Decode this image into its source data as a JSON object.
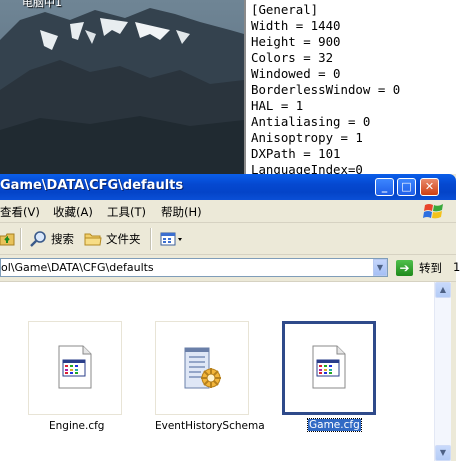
{
  "desktop": {
    "label": "电脑中1"
  },
  "notepad": {
    "lines": [
      "[General]",
      "Width = 1440",
      "Height = 900",
      "Colors = 32",
      "Windowed = 0",
      "BorderlessWindow = 0",
      "HAL = 1",
      "Antialiasing = 0",
      "Anisoptropy = 1",
      "DXPath = 101",
      "LanguageIndex=0"
    ]
  },
  "window": {
    "title": "Game\\DATA\\CFG\\defaults",
    "controls": {
      "minimize": "_",
      "maximize": "□",
      "close": "✕"
    }
  },
  "menu": {
    "items": [
      "查看(V)",
      "收藏(A)",
      "工具(T)",
      "帮助(H)"
    ]
  },
  "toolbar": {
    "search_label": "搜索",
    "folders_label": "文件夹"
  },
  "address": {
    "value": "ol\\Game\\DATA\\CFG\\defaults",
    "go_label": "转到",
    "tail": "1"
  },
  "files": [
    {
      "name": "Engine.cfg",
      "icon": "config-file-icon",
      "selected": false
    },
    {
      "name": "EventHistorySchema",
      "icon": "notepad-config-icon",
      "selected": false
    },
    {
      "name": "Game.cfg",
      "icon": "config-file-icon",
      "selected": true
    }
  ]
}
